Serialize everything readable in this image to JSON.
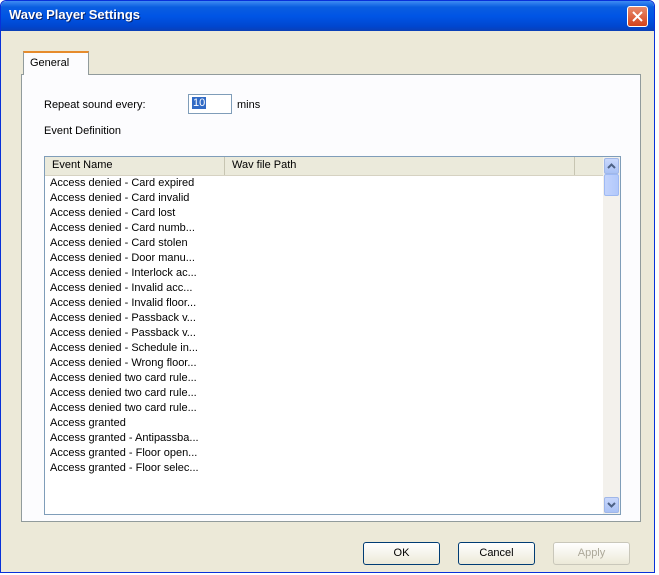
{
  "window": {
    "title": "Wave Player Settings"
  },
  "tabs": [
    {
      "label": "General"
    }
  ],
  "general": {
    "repeat_label": "Repeat sound every:",
    "repeat_value": "10",
    "mins_label": "mins",
    "event_definition_label": "Event Definition"
  },
  "list": {
    "columns": [
      {
        "label": "Event Name"
      },
      {
        "label": "Wav file Path"
      }
    ],
    "rows": [
      {
        "event_name": "Access denied - Card expired",
        "wav_path": ""
      },
      {
        "event_name": "Access denied - Card invalid",
        "wav_path": ""
      },
      {
        "event_name": "Access denied - Card lost",
        "wav_path": ""
      },
      {
        "event_name": "Access denied - Card numb...",
        "wav_path": ""
      },
      {
        "event_name": "Access denied - Card stolen",
        "wav_path": ""
      },
      {
        "event_name": "Access denied - Door manu...",
        "wav_path": ""
      },
      {
        "event_name": "Access denied - Interlock ac...",
        "wav_path": ""
      },
      {
        "event_name": "Access denied - Invalid acc...",
        "wav_path": ""
      },
      {
        "event_name": "Access denied - Invalid floor...",
        "wav_path": ""
      },
      {
        "event_name": "Access denied - Passback v...",
        "wav_path": ""
      },
      {
        "event_name": "Access denied - Passback v...",
        "wav_path": ""
      },
      {
        "event_name": "Access denied - Schedule in...",
        "wav_path": ""
      },
      {
        "event_name": "Access denied - Wrong floor...",
        "wav_path": ""
      },
      {
        "event_name": "Access denied two card rule...",
        "wav_path": ""
      },
      {
        "event_name": "Access denied two card rule...",
        "wav_path": ""
      },
      {
        "event_name": "Access denied two card rule...",
        "wav_path": ""
      },
      {
        "event_name": "Access granted",
        "wav_path": ""
      },
      {
        "event_name": "Access granted - Antipassba...",
        "wav_path": ""
      },
      {
        "event_name": "Access granted - Floor open...",
        "wav_path": ""
      },
      {
        "event_name": "Access granted - Floor selec...",
        "wav_path": ""
      }
    ]
  },
  "buttons": {
    "ok": "OK",
    "cancel": "Cancel",
    "apply": "Apply"
  },
  "icons": {
    "close": "close-icon",
    "scroll_up": "arrow-up-icon",
    "scroll_down": "arrow-down-icon"
  },
  "colors": {
    "titlebar": "#0055e5",
    "close": "#d5421b",
    "dialog_bg": "#ece9d8",
    "selection": "#316ac5"
  }
}
